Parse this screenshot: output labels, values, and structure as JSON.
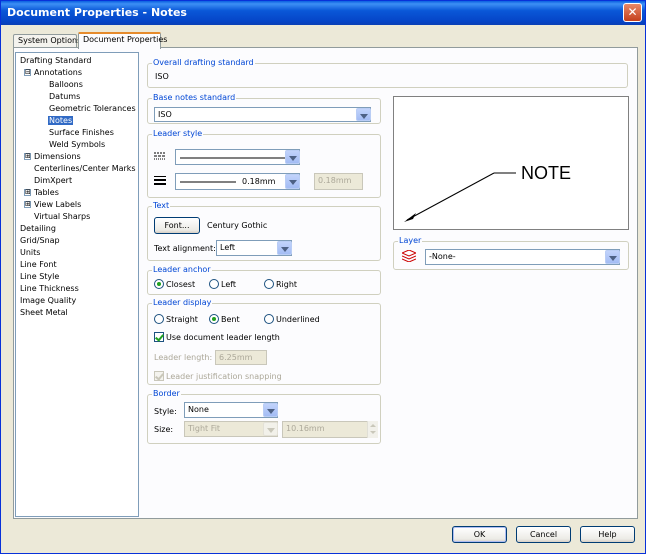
{
  "window": {
    "title": "Document Properties - Notes",
    "close_glyph": "✕"
  },
  "tabs": [
    {
      "label": "System Options"
    },
    {
      "label": "Document Properties"
    }
  ],
  "tree": {
    "items": [
      {
        "label": "Drafting Standard"
      },
      {
        "label": "Annotations",
        "expander": "⊟"
      },
      {
        "label": "Balloons"
      },
      {
        "label": "Datums"
      },
      {
        "label": "Geometric Tolerances"
      },
      {
        "label": "Notes"
      },
      {
        "label": "Surface Finishes"
      },
      {
        "label": "Weld Symbols"
      },
      {
        "label": "Dimensions",
        "expander": "⊞"
      },
      {
        "label": "Centerlines/Center Marks"
      },
      {
        "label": "DimXpert"
      },
      {
        "label": "Tables",
        "expander": "⊞"
      },
      {
        "label": "View Labels",
        "expander": "⊞"
      },
      {
        "label": "Virtual Sharps"
      },
      {
        "label": "Detailing"
      },
      {
        "label": "Grid/Snap"
      },
      {
        "label": "Units"
      },
      {
        "label": "Line Font"
      },
      {
        "label": "Line Style"
      },
      {
        "label": "Line Thickness"
      },
      {
        "label": "Image Quality"
      },
      {
        "label": "Sheet Metal"
      }
    ],
    "selected": "Notes"
  },
  "overall": {
    "title": "Overall drafting standard",
    "value": "ISO"
  },
  "base_notes": {
    "title": "Base notes standard",
    "value": "ISO"
  },
  "leader_style": {
    "title": "Leader style",
    "thickness_value": "0.18mm",
    "custom_value": "0.18mm"
  },
  "text": {
    "title": "Text",
    "font_button": "Font...",
    "font_name": "Century Gothic",
    "alignment_label": "Text alignment:",
    "alignment_value": "Left"
  },
  "leader_anchor": {
    "title": "Leader anchor",
    "options": [
      "Closest",
      "Left",
      "Right"
    ],
    "selected": "Closest"
  },
  "leader_display": {
    "title": "Leader display",
    "options": [
      "Straight",
      "Bent",
      "Underlined"
    ],
    "selected": "Bent",
    "use_doc_length": "Use document leader length",
    "use_doc_length_checked": true,
    "length_label": "Leader length:",
    "length_value": "6.25mm",
    "snapping": "Leader justification snapping",
    "snapping_checked": true
  },
  "border": {
    "title": "Border",
    "style_label": "Style:",
    "style_value": "None",
    "size_label": "Size:",
    "size_value": "Tight Fit",
    "size_mm": "10.16mm"
  },
  "preview": {
    "note_text": "NOTE"
  },
  "layer": {
    "title": "Layer",
    "value": "-None-"
  },
  "footer": {
    "ok": "OK",
    "cancel": "Cancel",
    "help": "Help"
  },
  "colors": {
    "title_bar": "#0a58d8",
    "group_title": "#0046d5",
    "selection": "#316ac5"
  }
}
